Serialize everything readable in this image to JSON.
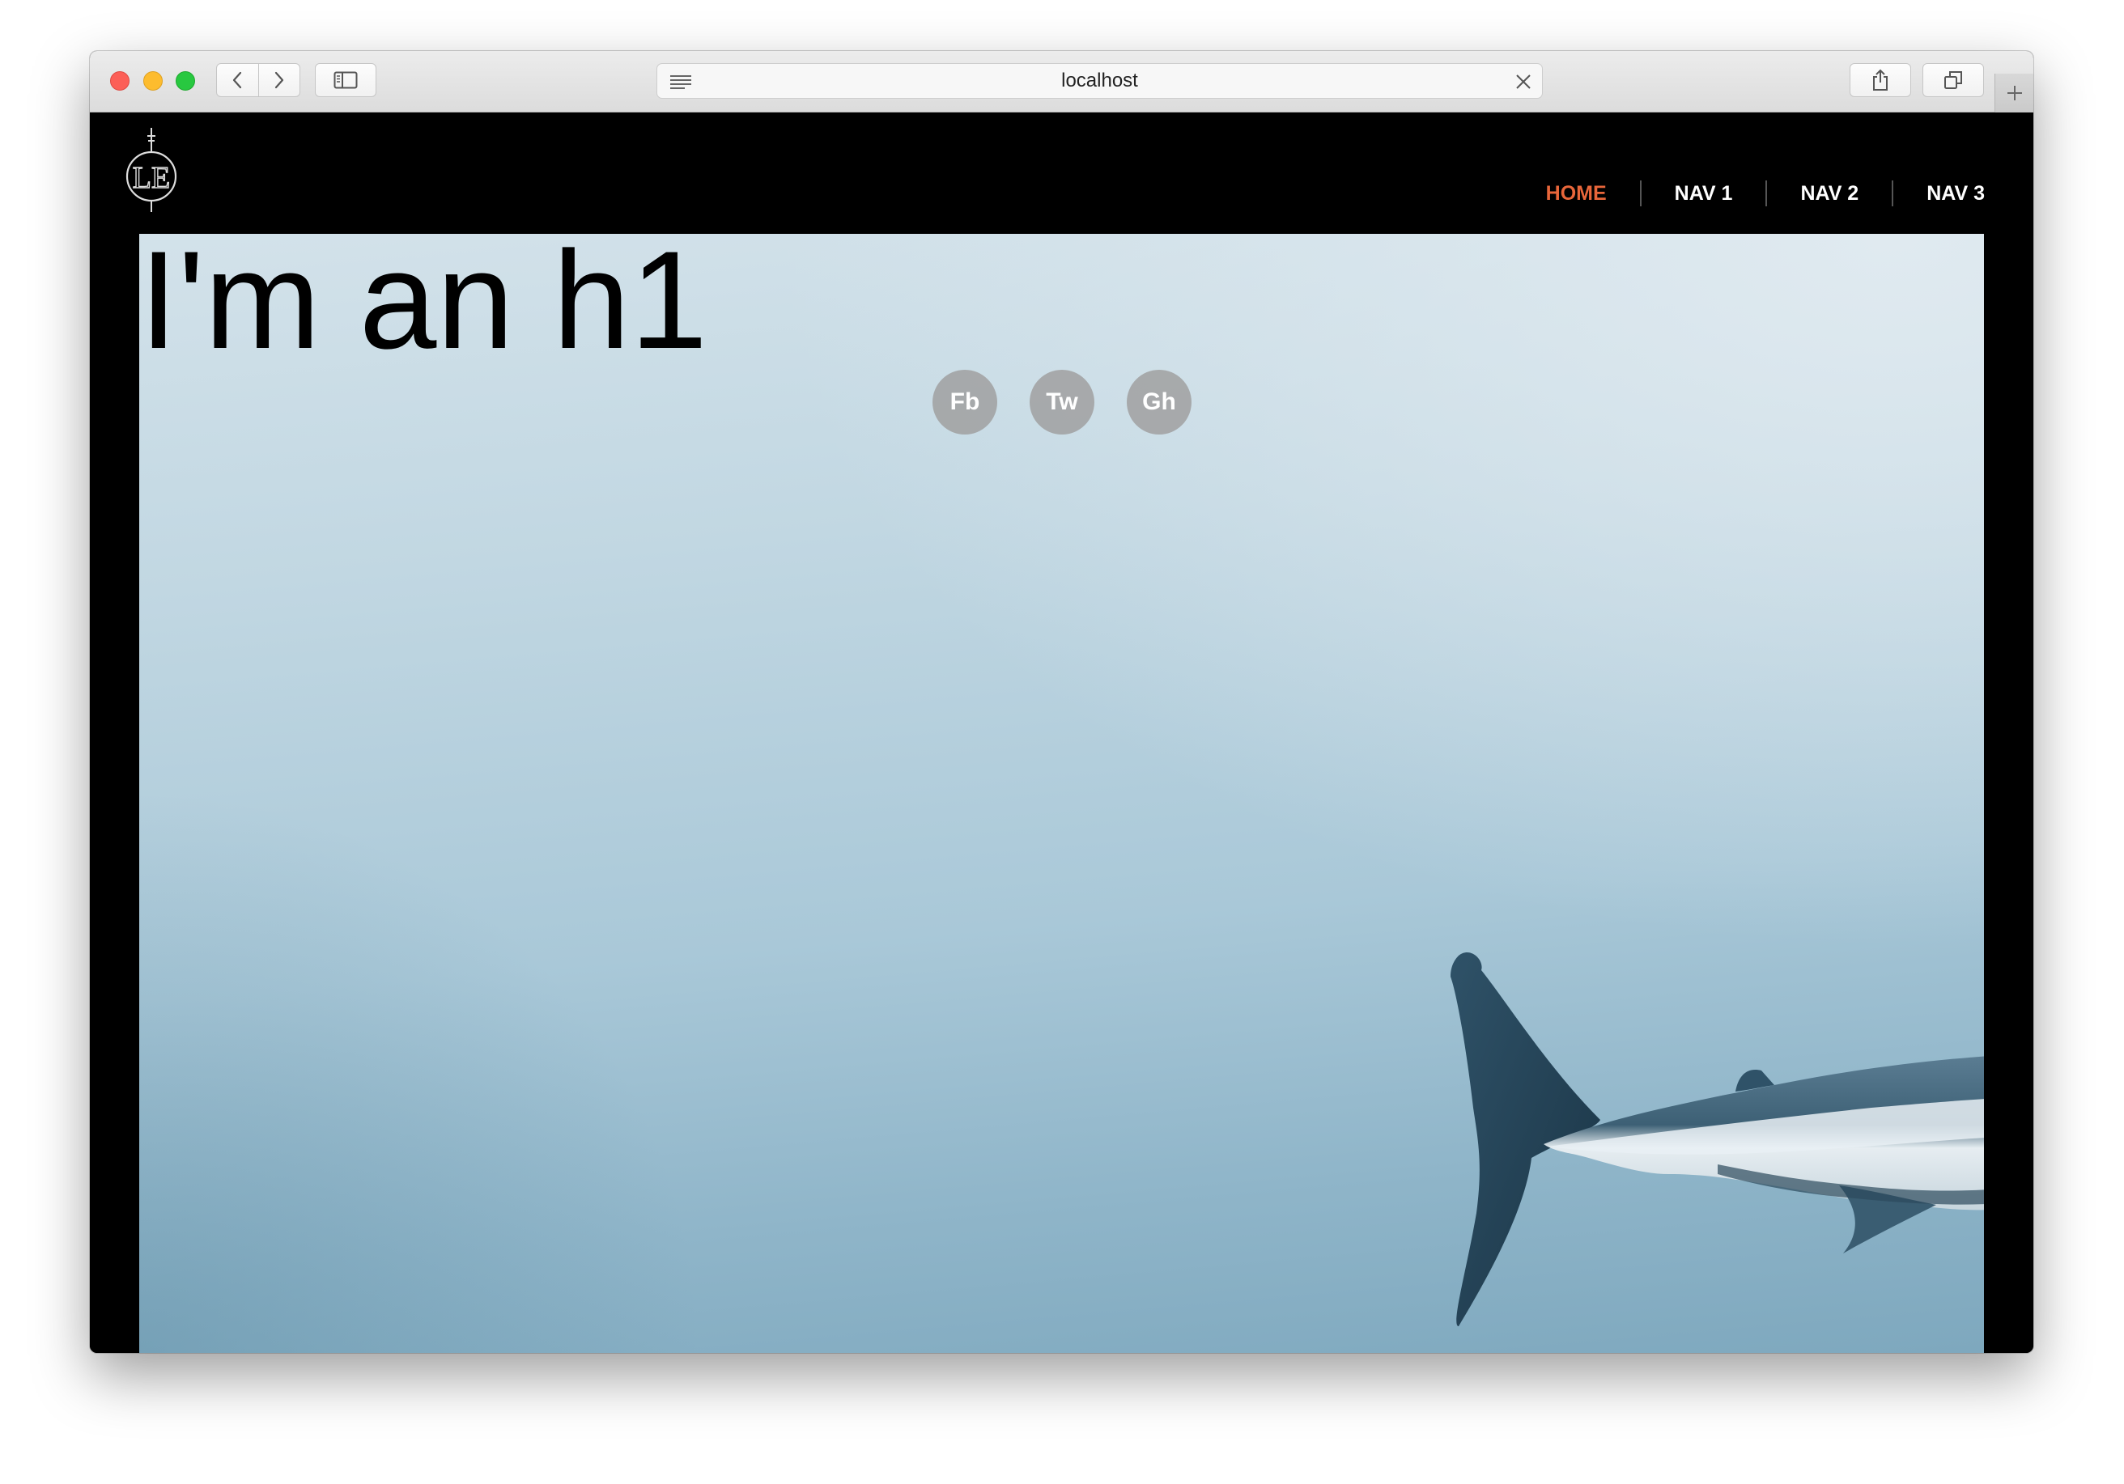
{
  "browser": {
    "url": "localhost",
    "icons": {
      "back": "chevron-left-icon",
      "forward": "chevron-right-icon",
      "sidebar": "sidebar-icon",
      "reader": "reader-icon",
      "stop": "close-icon",
      "share": "share-icon",
      "tabs": "tabs-icon",
      "new_tab": "plus-icon"
    }
  },
  "header": {
    "logo_text": "LE",
    "nav": [
      {
        "label": "HOME",
        "active": true
      },
      {
        "label": "NAV 1",
        "active": false
      },
      {
        "label": "NAV 2",
        "active": false
      },
      {
        "label": "NAV 3",
        "active": false
      }
    ]
  },
  "hero": {
    "title": "I'm an h1",
    "social": [
      {
        "label": "Fb"
      },
      {
        "label": "Tw"
      },
      {
        "label": "Gh"
      }
    ],
    "image": "shark-tail"
  },
  "colors": {
    "active_nav": "#e8663a",
    "page_bg": "#000000",
    "social_bg": "#a0a0a0"
  }
}
